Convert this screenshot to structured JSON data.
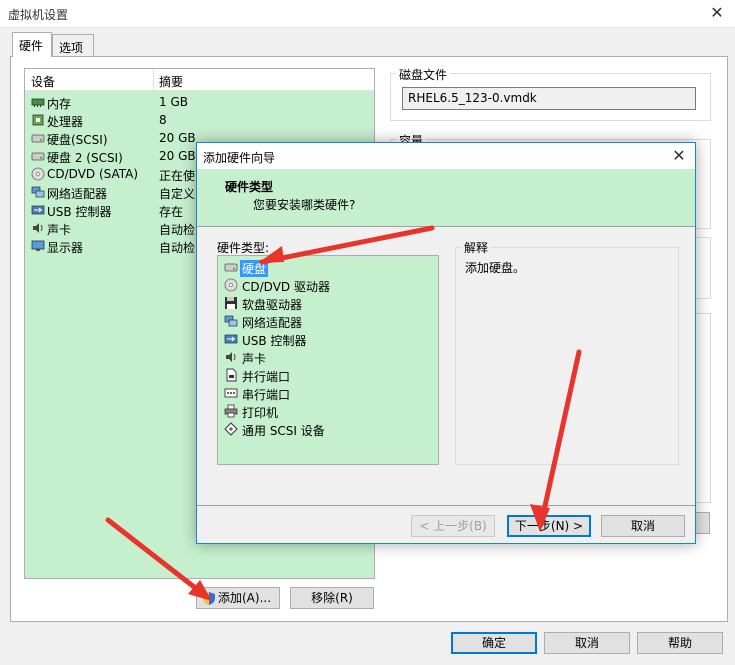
{
  "window": {
    "title": "虚拟机设置",
    "close": "✕"
  },
  "tabs": [
    {
      "label": "硬件"
    },
    {
      "label": "选项"
    }
  ],
  "device_list": {
    "headers": [
      "设备",
      "摘要"
    ],
    "rows": [
      {
        "name": "内存",
        "summary": "1 GB",
        "icon": "memory-icon"
      },
      {
        "name": "处理器",
        "summary": "8",
        "icon": "cpu-icon"
      },
      {
        "name": "硬盘(SCSI)",
        "summary": "20 GB",
        "icon": "harddisk-icon"
      },
      {
        "name": "硬盘 2 (SCSI)",
        "summary": "20 GB",
        "icon": "harddisk-icon"
      },
      {
        "name": "CD/DVD (SATA)",
        "summary": "正在使",
        "icon": "cd-icon"
      },
      {
        "name": "网络适配器",
        "summary": "自定义",
        "icon": "network-icon"
      },
      {
        "name": "USB 控制器",
        "summary": "存在",
        "icon": "usb-icon"
      },
      {
        "name": "声卡",
        "summary": "自动检",
        "icon": "sound-icon"
      },
      {
        "name": "显示器",
        "summary": "自动检",
        "icon": "monitor-icon"
      }
    ]
  },
  "buttons": {
    "add": "添加(A)...",
    "remove": "移除(R)",
    "ok": "确定",
    "cancel": "取消",
    "help": "帮助"
  },
  "disk_file": {
    "label": "磁盘文件",
    "value": "RHEL6.5_123-0.vmdk"
  },
  "capacity": {
    "label": "容量"
  },
  "wizard": {
    "title": "添加硬件向导",
    "close": "✕",
    "header": "硬件类型",
    "subheader": "您要安装哪类硬件?",
    "list_label": "硬件类型:",
    "items": [
      {
        "name": "硬盘",
        "icon": "harddisk-icon"
      },
      {
        "name": "CD/DVD 驱动器",
        "icon": "cd-icon"
      },
      {
        "name": "软盘驱动器",
        "icon": "floppy-icon"
      },
      {
        "name": "网络适配器",
        "icon": "network-icon"
      },
      {
        "name": "USB 控制器",
        "icon": "usb-icon"
      },
      {
        "name": "声卡",
        "icon": "sound-icon"
      },
      {
        "name": "并行端口",
        "icon": "parallel-port-icon"
      },
      {
        "name": "串行端口",
        "icon": "serial-port-icon"
      },
      {
        "name": "打印机",
        "icon": "printer-icon"
      },
      {
        "name": "通用 SCSI 设备",
        "icon": "scsi-icon"
      }
    ],
    "selected_index": 0,
    "explain_label": "解释",
    "explain_text": "添加硬盘。",
    "back": "< 上一步(B)",
    "next": "下一步(N) >",
    "cancel": "取消"
  },
  "colors": {
    "list_bg": "#c6efce",
    "accent": "#0078d7",
    "arrow": "#e8342b"
  }
}
